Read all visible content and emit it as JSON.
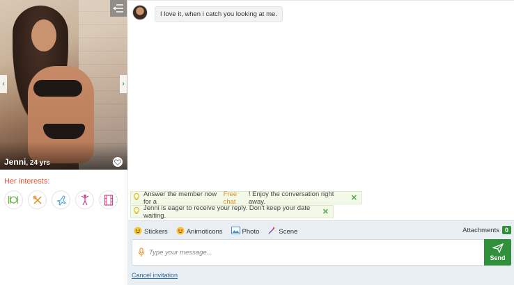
{
  "profile": {
    "name": "Jenni",
    "age": ", 24 yrs",
    "interests_title": "Her interests:",
    "interests": [
      {
        "icon": "dining-icon"
      },
      {
        "icon": "cooking-icon"
      },
      {
        "icon": "travel-icon"
      },
      {
        "icon": "dance-icon"
      },
      {
        "icon": "movies-icon"
      }
    ]
  },
  "conversation": {
    "messages": [
      {
        "text": "I love it, when i catch you looking at me."
      }
    ]
  },
  "hints": {
    "first_before": "Answer the member now for a ",
    "first_link": "Free chat",
    "first_after": "! Enjoy the conversation right away.",
    "second": "Jenni is eager to receive your reply. Don't keep your date waiting."
  },
  "composer": {
    "tools": [
      "Stickers",
      "Animoticons",
      "Photo",
      "Scene"
    ],
    "attachments_label": "Attachments",
    "attachments_count": "0",
    "placeholder": "Type your message...",
    "send_label": "Send",
    "cancel_label": "Cancel invitation"
  },
  "colors": {
    "accent_green": "#2f8f3b",
    "interest_title": "#e1523a",
    "free_chat": "#e88a1a",
    "hint_bg": "#f2f9e8"
  }
}
